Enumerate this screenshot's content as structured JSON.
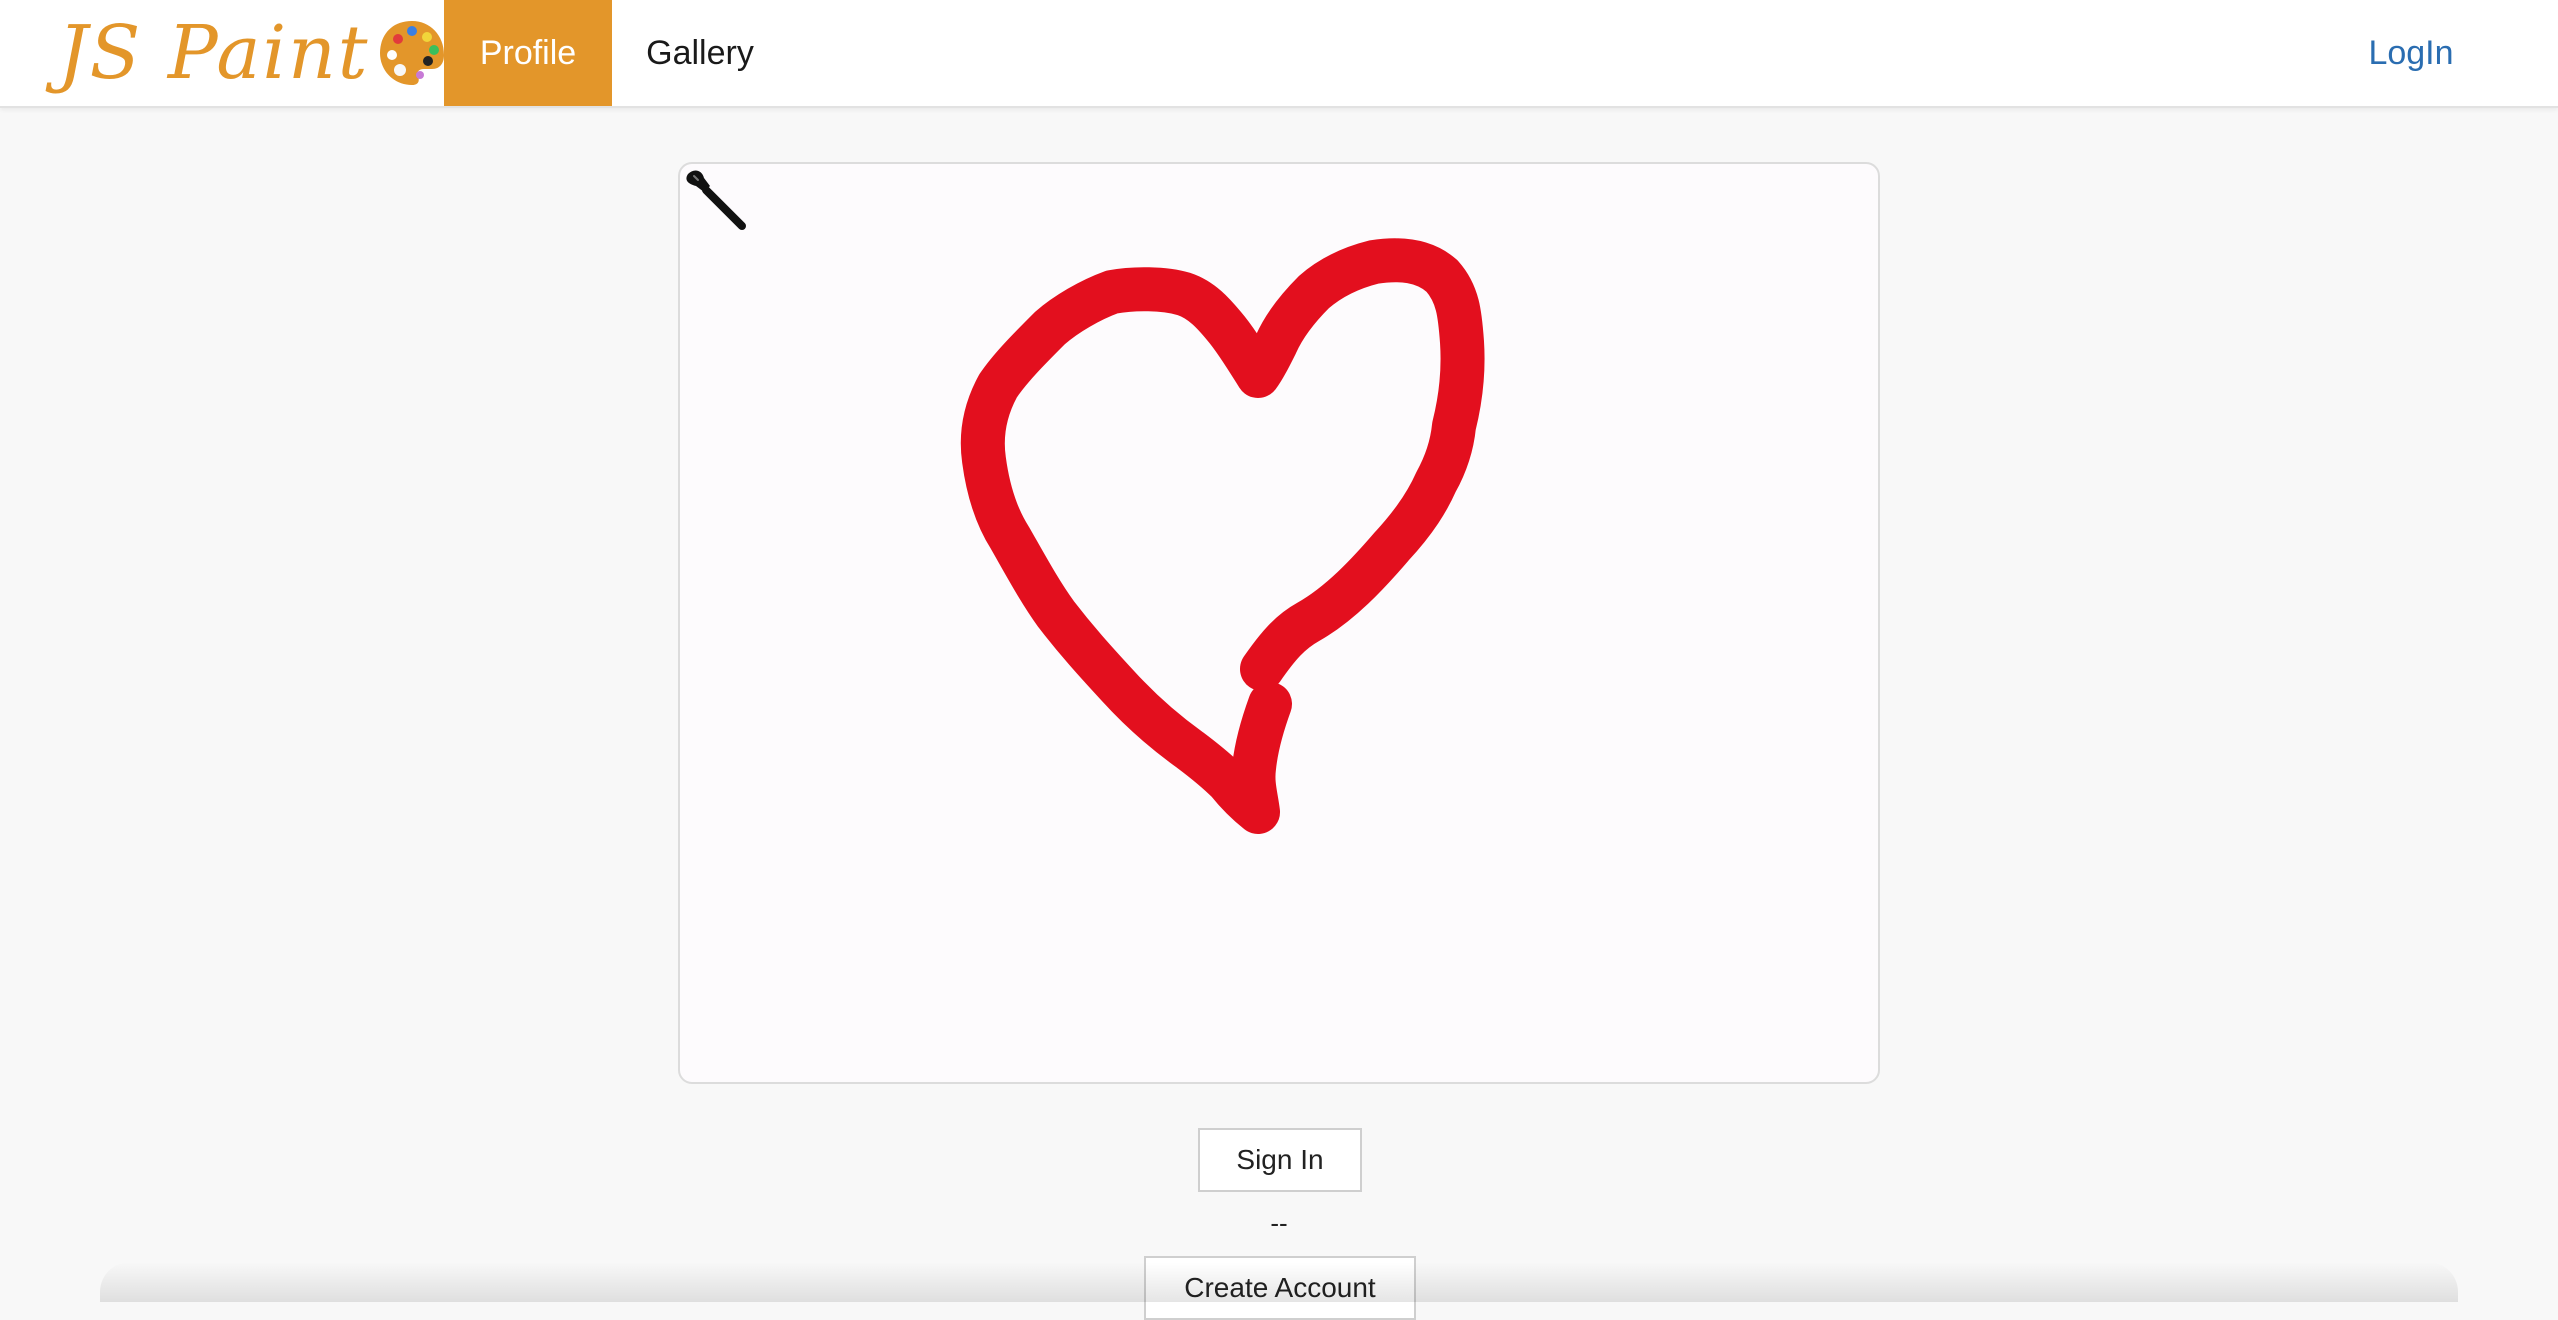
{
  "brand": {
    "name": "JS Paint",
    "icon": "artist-palette-icon"
  },
  "nav": {
    "items": [
      {
        "label": "Profile",
        "active": true
      },
      {
        "label": "Gallery",
        "active": false
      }
    ],
    "login_label": "LogIn"
  },
  "canvas": {
    "drawing": "heart",
    "stroke_color": "#e30f1e",
    "cursor_icon": "paintbrush-cursor-icon"
  },
  "auth": {
    "sign_in_label": "Sign In",
    "separator": "--",
    "create_account_label": "Create Account"
  },
  "colors": {
    "accent": "#e3962a",
    "link": "#2a6db1",
    "background": "#f8f8f8"
  }
}
